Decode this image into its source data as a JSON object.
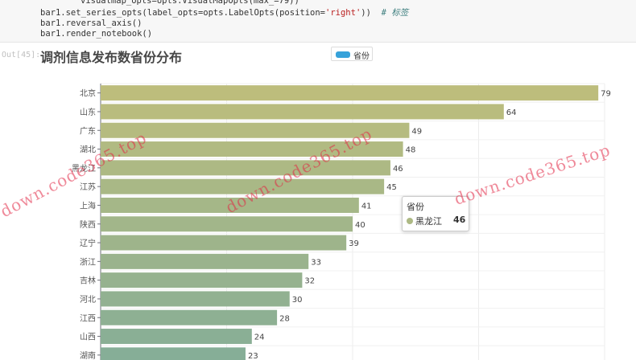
{
  "code": {
    "line0": "visualmap_opts=opts.VisualMapOpts(max_=79))",
    "line1_pre": "bar1.set_series_opts(label_opts=opts.LabelOpts(position=",
    "line1_str": "'right'",
    "line1_post": "))  ",
    "line1_comment": "# 标签",
    "line2": "bar1.reversal_axis()",
    "line3": "bar1.render_notebook()"
  },
  "prompt": "Out[45]:",
  "colors": {
    "legend": "#37a2da",
    "bar_top": "#bdbd7c",
    "bar_bottom": "#86ae97",
    "watermark": "#e12846"
  },
  "chart_data": {
    "type": "bar",
    "orientation": "horizontal",
    "title": "调剂信息发布数省份分布",
    "legend": [
      "省份"
    ],
    "categories": [
      "北京",
      "山东",
      "广东",
      "湖北",
      "黑龙江",
      "江苏",
      "上海",
      "陕西",
      "辽宁",
      "浙江",
      "吉林",
      "河北",
      "江西",
      "山西",
      "湖南"
    ],
    "series": [
      {
        "name": "省份",
        "values": [
          79,
          64,
          49,
          48,
          46,
          45,
          41,
          40,
          39,
          33,
          32,
          30,
          28,
          24,
          23
        ]
      }
    ],
    "xlim": [
      0,
      80
    ],
    "grid": true,
    "labels_position": "right"
  },
  "tooltip": {
    "title": "省份",
    "name": "黑龙江",
    "value": "46"
  },
  "watermarks": [
    "down.code365.top",
    "down.code365.top",
    "down.code365.top"
  ]
}
